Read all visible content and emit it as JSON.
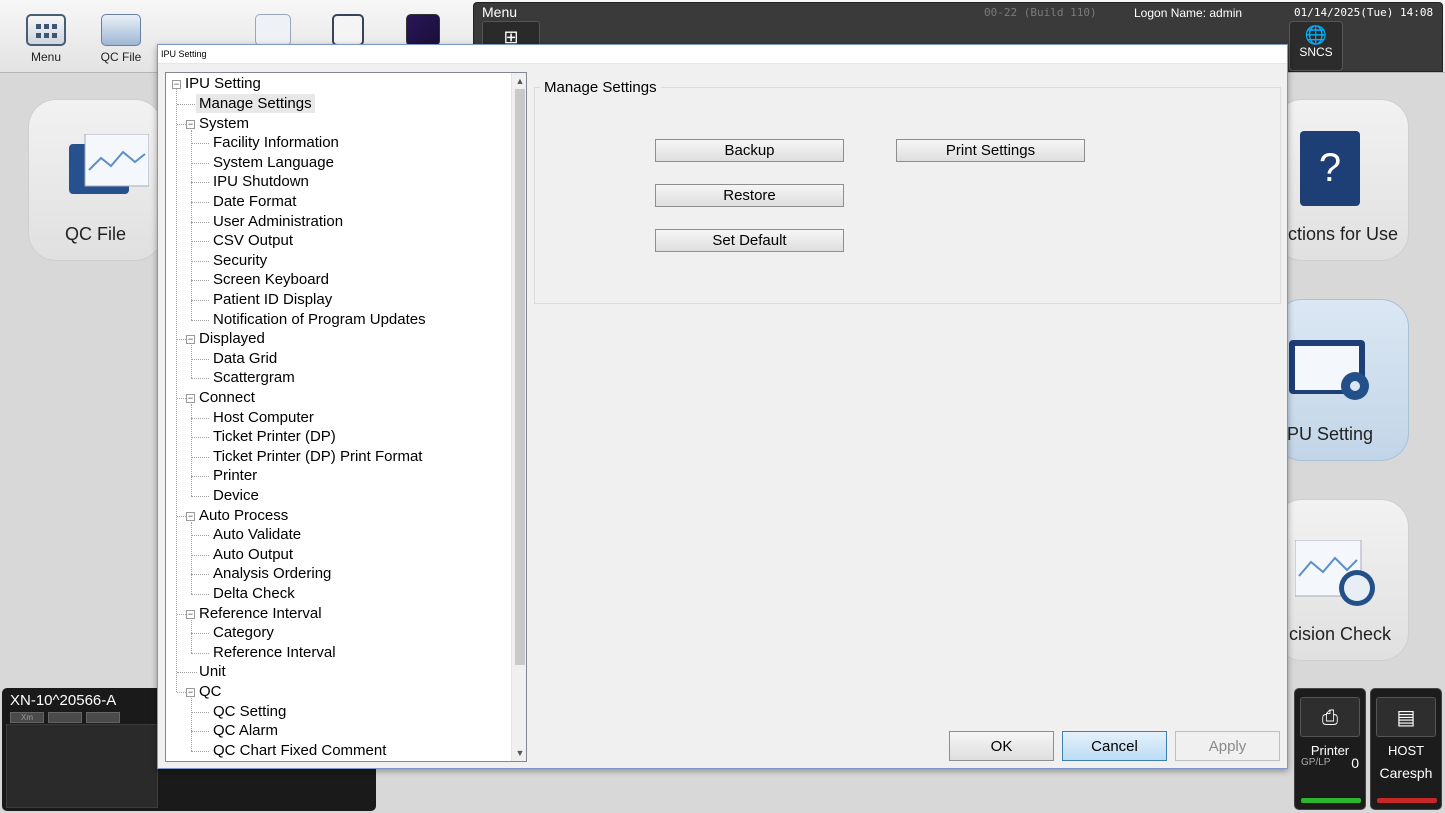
{
  "app": {
    "topbar": [
      {
        "label": "Menu",
        "icon": "menu-grid-icon"
      },
      {
        "label": "QC File",
        "icon": "qc-file-icon"
      },
      {
        "label": "",
        "icon": "document-list-icon"
      },
      {
        "label": "",
        "icon": "document-search-icon"
      },
      {
        "label": "",
        "icon": "analysis-graph-icon"
      }
    ],
    "header": {
      "menu_title": "Menu",
      "build": "00-22 (Build 110)",
      "logon": "Logon Name: admin",
      "datetime": "01/14/2025(Tue) 14:08",
      "sncs_label": "SNCS",
      "sncs_badge": "SNCS"
    },
    "tiles": {
      "qc_file": "QC File",
      "instructions": "uctions for Use",
      "ipu_setting": "PU Setting",
      "decision_check": "cision Check"
    },
    "instrument": {
      "name": "XN-10^20566-A",
      "chips": [
        "Xm",
        "",
        ""
      ]
    },
    "status": [
      {
        "label": "Printer",
        "sub": "GP/LP",
        "value": "0",
        "bar_color": "#2db52d"
      },
      {
        "label": "HOST",
        "sub": "Caresph",
        "value": "",
        "bar_color": "#c62828"
      }
    ]
  },
  "dialog": {
    "title": "IPU Setting",
    "tree": {
      "root": "IPU Setting",
      "items": [
        {
          "label": "Manage Settings",
          "level": 1,
          "selected": true
        },
        {
          "label": "System",
          "level": 1,
          "expander": true
        },
        {
          "label": "Facility Information",
          "level": 2
        },
        {
          "label": "System Language",
          "level": 2
        },
        {
          "label": "IPU Shutdown",
          "level": 2
        },
        {
          "label": "Date Format",
          "level": 2
        },
        {
          "label": "User Administration",
          "level": 2
        },
        {
          "label": "CSV Output",
          "level": 2
        },
        {
          "label": "Security",
          "level": 2
        },
        {
          "label": "Screen Keyboard",
          "level": 2
        },
        {
          "label": "Patient ID Display",
          "level": 2
        },
        {
          "label": "Notification of Program Updates",
          "level": 2
        },
        {
          "label": "Displayed",
          "level": 1,
          "expander": true
        },
        {
          "label": "Data Grid",
          "level": 2
        },
        {
          "label": "Scattergram",
          "level": 2
        },
        {
          "label": "Connect",
          "level": 1,
          "expander": true
        },
        {
          "label": "Host Computer",
          "level": 2
        },
        {
          "label": "Ticket Printer (DP)",
          "level": 2
        },
        {
          "label": "Ticket Printer (DP) Print Format",
          "level": 2
        },
        {
          "label": "Printer",
          "level": 2
        },
        {
          "label": "Device",
          "level": 2
        },
        {
          "label": "Auto Process",
          "level": 1,
          "expander": true
        },
        {
          "label": "Auto Validate",
          "level": 2
        },
        {
          "label": "Auto Output",
          "level": 2
        },
        {
          "label": "Analysis Ordering",
          "level": 2
        },
        {
          "label": "Delta Check",
          "level": 2
        },
        {
          "label": "Reference Interval",
          "level": 1,
          "expander": true
        },
        {
          "label": "Category",
          "level": 2
        },
        {
          "label": "Reference Interval",
          "level": 2
        },
        {
          "label": "Unit",
          "level": 1
        },
        {
          "label": "QC",
          "level": 1,
          "expander": true
        },
        {
          "label": "QC Setting",
          "level": 2
        },
        {
          "label": "QC Alarm",
          "level": 2
        },
        {
          "label": "QC Chart Fixed Comment",
          "level": 2
        }
      ]
    },
    "panel": {
      "title": "Manage Settings",
      "backup": "Backup",
      "print_settings": "Print Settings",
      "restore": "Restore",
      "set_default": "Set Default"
    },
    "footer": {
      "ok": "OK",
      "cancel": "Cancel",
      "apply": "Apply"
    }
  }
}
